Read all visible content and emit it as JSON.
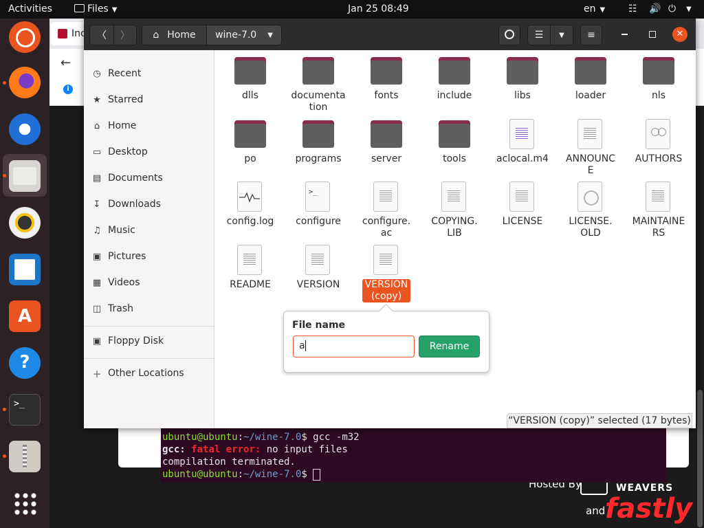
{
  "topbar": {
    "activities": "Activities",
    "app_menu": "Files",
    "clock": "Jan 25  08:49",
    "lang": "en"
  },
  "dock": {
    "apps": [
      "ubuntu",
      "firefox",
      "thunderbird",
      "files",
      "rhythmbox",
      "writer",
      "app-center",
      "help",
      "terminal",
      "archive",
      "show-apps"
    ]
  },
  "browser": {
    "tab_text": "Inc",
    "hosted_by": "Hosted By",
    "weavers": "WEAVERS",
    "and_text": "and",
    "fastly": "fastly"
  },
  "terminal": {
    "prompt_user": "ubuntu@ubuntu",
    "prompt_path": "~/wine-7.0",
    "cmd1": "gcc -m32",
    "err_prefix": "gcc:",
    "err_word": "fatal error:",
    "err_msg": "no input files",
    "line3": "compilation terminated."
  },
  "files_window": {
    "path_home": "Home",
    "path_current": "wine-7.0",
    "sidebar": [
      {
        "label": "Recent",
        "icon": "clock-icon"
      },
      {
        "label": "Starred",
        "icon": "star-icon"
      },
      {
        "label": "Home",
        "icon": "home-icon"
      },
      {
        "label": "Desktop",
        "icon": "desktop-icon"
      },
      {
        "label": "Documents",
        "icon": "documents-icon"
      },
      {
        "label": "Downloads",
        "icon": "downloads-icon"
      },
      {
        "label": "Music",
        "icon": "music-icon"
      },
      {
        "label": "Pictures",
        "icon": "pictures-icon"
      },
      {
        "label": "Videos",
        "icon": "videos-icon"
      },
      {
        "label": "Trash",
        "icon": "trash-icon"
      },
      {
        "label": "Floppy Disk",
        "icon": "floppy-icon"
      },
      {
        "label": "Other Locations",
        "icon": "plus-icon"
      }
    ],
    "files": [
      {
        "name": "dlls",
        "type": "folder"
      },
      {
        "name": "documenta\ntion",
        "type": "folder"
      },
      {
        "name": "fonts",
        "type": "folder"
      },
      {
        "name": "include",
        "type": "folder"
      },
      {
        "name": "libs",
        "type": "folder"
      },
      {
        "name": "loader",
        "type": "folder"
      },
      {
        "name": "nls",
        "type": "folder"
      },
      {
        "name": "po",
        "type": "folder"
      },
      {
        "name": "programs",
        "type": "folder"
      },
      {
        "name": "server",
        "type": "folder"
      },
      {
        "name": "tools",
        "type": "folder"
      },
      {
        "name": "aclocal.m4",
        "type": "m4"
      },
      {
        "name": "ANNOUNC\nE",
        "type": "text"
      },
      {
        "name": "AUTHORS",
        "type": "authors"
      },
      {
        "name": "config.log",
        "type": "log"
      },
      {
        "name": "configure",
        "type": "script"
      },
      {
        "name": "configure.\nac",
        "type": "text"
      },
      {
        "name": "COPYING.\nLIB",
        "type": "text"
      },
      {
        "name": "LICENSE",
        "type": "text"
      },
      {
        "name": "LICENSE.\nOLD",
        "type": "old"
      },
      {
        "name": "MAINTAINE\nRS",
        "type": "text"
      },
      {
        "name": "README",
        "type": "text"
      },
      {
        "name": "VERSION",
        "type": "text"
      },
      {
        "name": "VERSION\n(copy)",
        "type": "text",
        "selected": true
      }
    ],
    "rename": {
      "title": "File name",
      "value": "a",
      "button": "Rename"
    },
    "status": "“VERSION (copy)” selected  (17 bytes)"
  }
}
